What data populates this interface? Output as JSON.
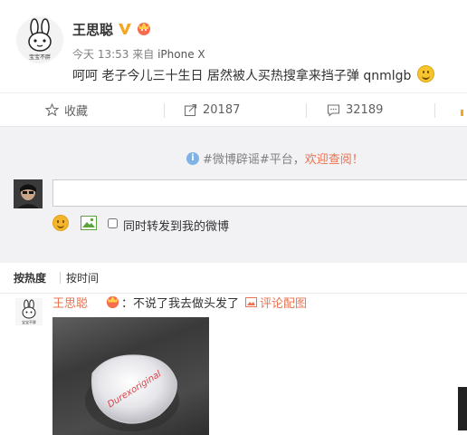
{
  "post": {
    "author": "王思聪",
    "meta_time": "今天 13:53",
    "meta_from": "来自",
    "meta_source": "iPhone X",
    "text": "呵呵 老子今儿三十生日 居然被人买热搜拿来挡子弹 qnmlgb",
    "avatar_caption": "宝宝不胖"
  },
  "actions": {
    "favorite_label": "收藏",
    "repost_count": "20187",
    "comment_count": "32189"
  },
  "comment_box": {
    "notice_link": "#微博辟谣#平台，",
    "notice_highlight": "欢迎查阅！",
    "input_value": "",
    "repost_label": "同时转发到我的微博"
  },
  "sort": {
    "by_hot": "按热度",
    "by_time": "按时间"
  },
  "comment": {
    "author": "王思聪",
    "text": "：不说了我去做头发了",
    "image_link": "评论配图",
    "avatar_caption": "宝宝不胖",
    "photo_text": "Durexoriginal"
  },
  "colors": {
    "accent": "#eb7350",
    "verified": "#f5a623",
    "background_gray": "#f2f2f5"
  }
}
